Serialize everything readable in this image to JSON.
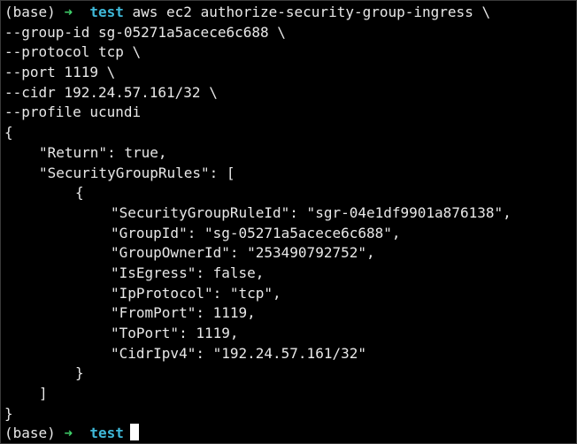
{
  "terminal": {
    "prompt_env": "(base)",
    "prompt_arrow": "➜",
    "prompt_dir": "test",
    "command_first": " aws ec2 authorize-security-group-ingress \\",
    "continuations": [
      "--group-id sg-05271a5acece6c688 \\",
      "--protocol tcp \\",
      "--port 1119 \\",
      "--cidr 192.24.57.161/32 \\",
      "--profile ucundi"
    ],
    "output": {
      "open_brace": "{",
      "return_line": "\"Return\": true,",
      "rules_open": "\"SecurityGroupRules\": [",
      "item_open": "{",
      "fields": [
        "\"SecurityGroupRuleId\": \"sgr-04e1df9901a876138\",",
        "\"GroupId\": \"sg-05271a5acece6c688\",",
        "\"GroupOwnerId\": \"253490792752\",",
        "\"IsEgress\": false,",
        "\"IpProtocol\": \"tcp\",",
        "\"FromPort\": 1119,",
        "\"ToPort\": 1119,",
        "\"CidrIpv4\": \"192.24.57.161/32\""
      ],
      "item_close": "}",
      "rules_close": "]",
      "close_brace": "}"
    },
    "colors": {
      "background": "#000000",
      "text": "#e8e8e8",
      "prompt_arrow": "#3fd06a",
      "prompt_dir": "#3fb8d8"
    }
  }
}
